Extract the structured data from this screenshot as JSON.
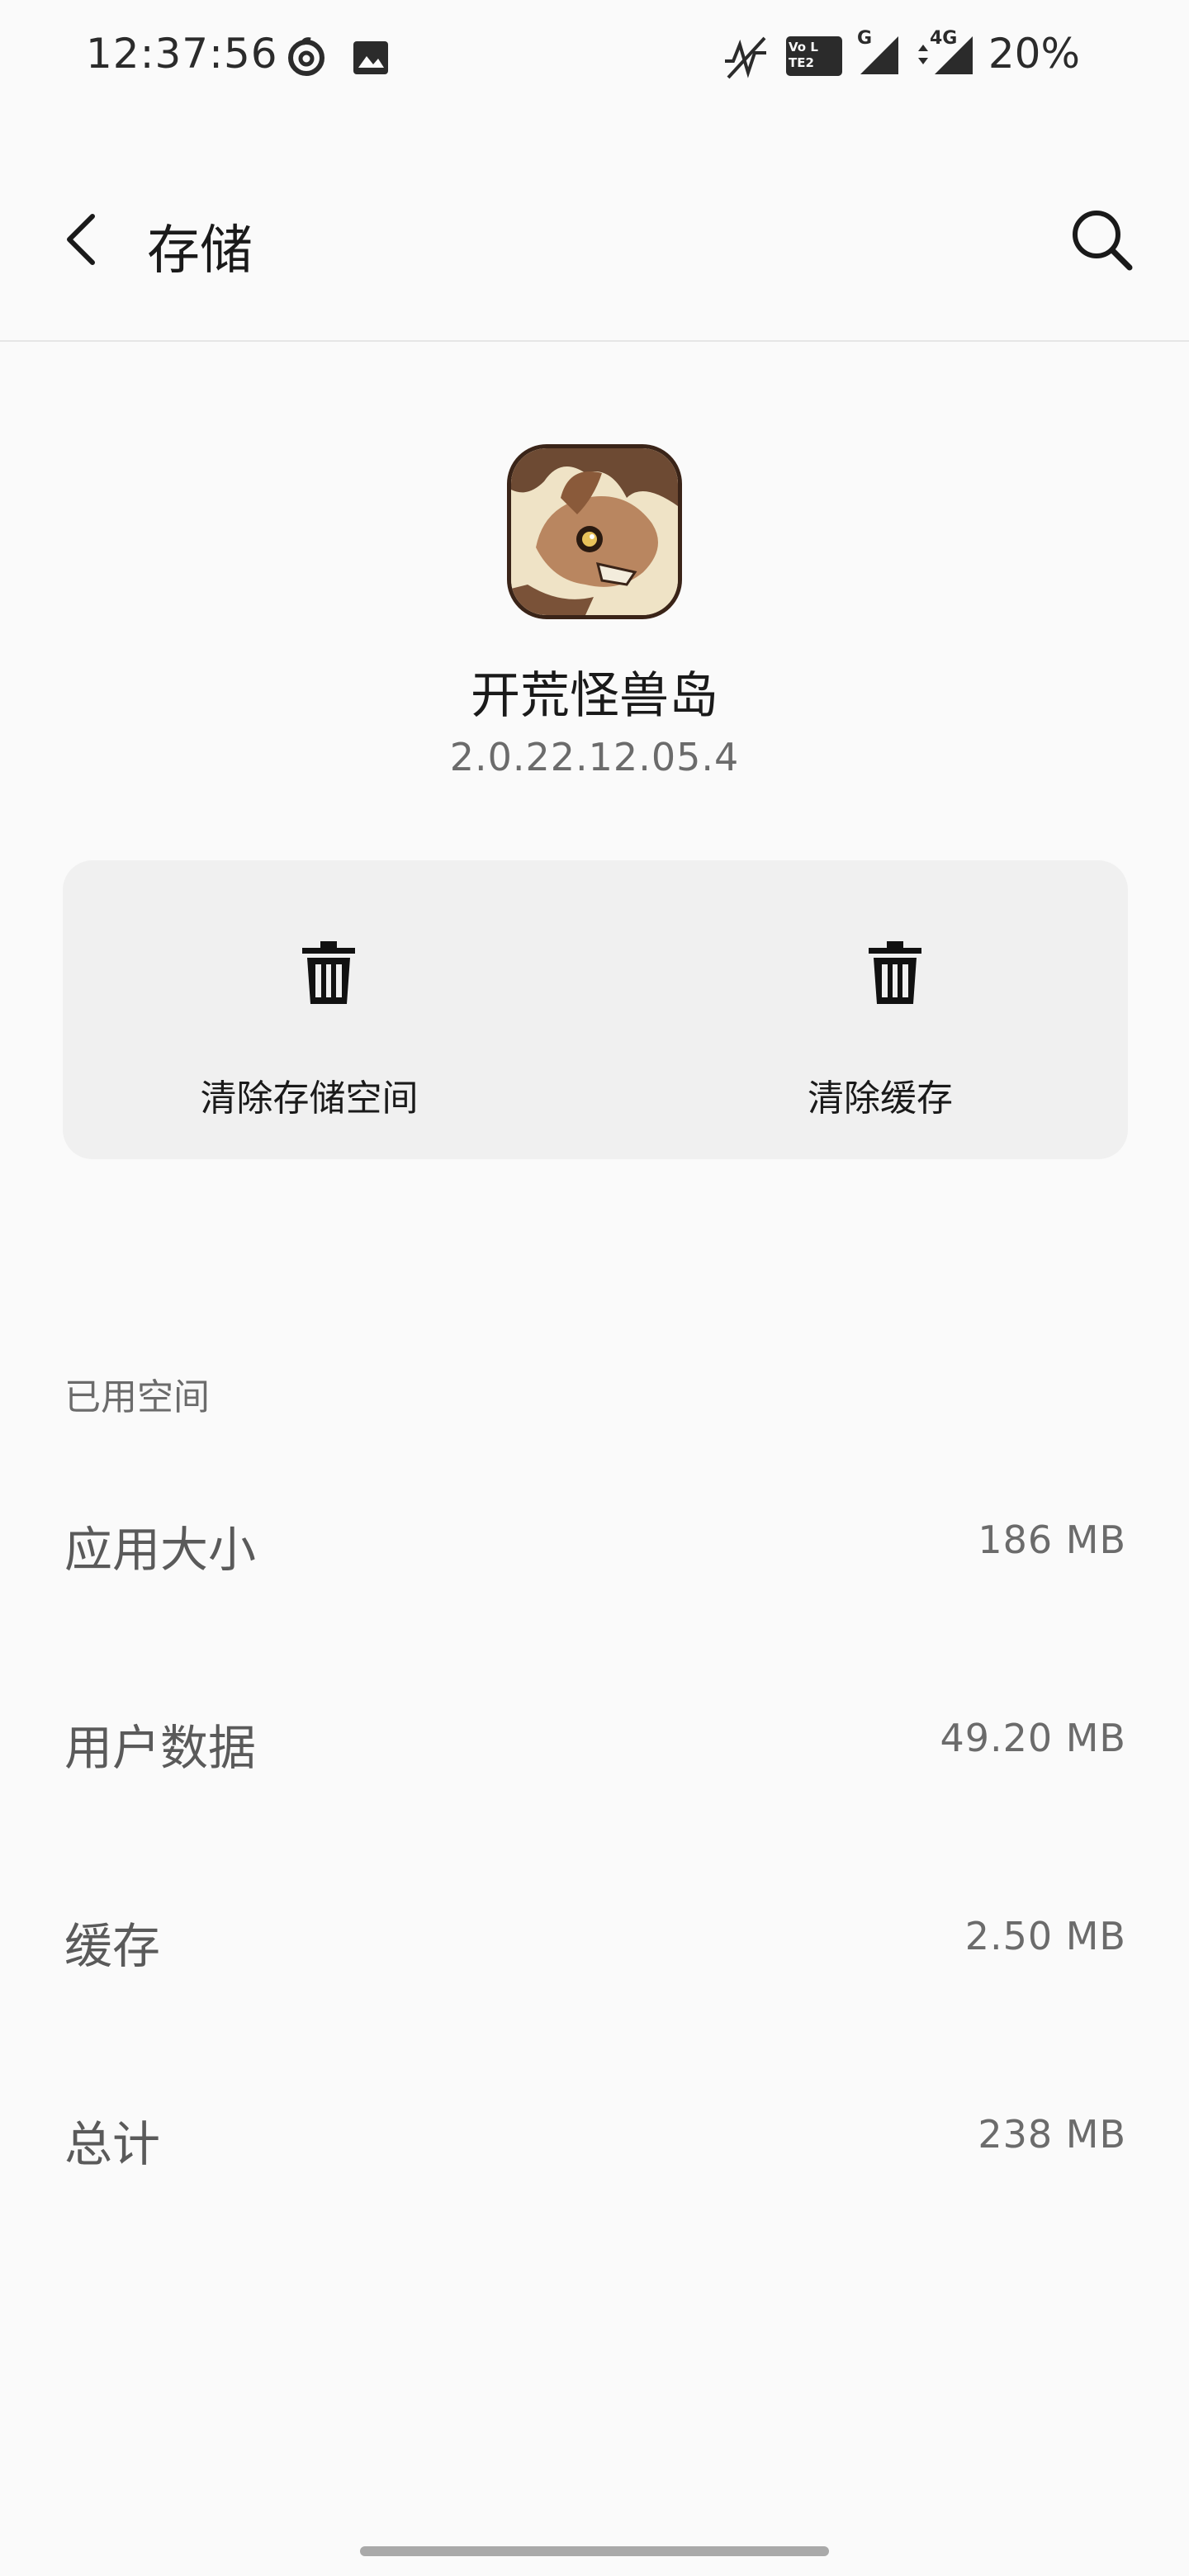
{
  "status_bar": {
    "time": "12:37:56",
    "battery": "20%",
    "icons": [
      "netease-music-icon",
      "image-notification-icon",
      "no-signal-icon",
      "volte-lte2-icon",
      "signal-g-icon",
      "signal-4g-icon"
    ],
    "volte_label": "Vo LTE2",
    "g_label": "G",
    "fourg_label": "4G"
  },
  "app_bar": {
    "title": "存储",
    "back_icon": "back-arrow-icon",
    "search_icon": "search-icon"
  },
  "app": {
    "name": "开荒怪兽岛",
    "version": "2.0.22.12.05.4"
  },
  "actions": {
    "clear_storage": "清除存储空间",
    "clear_cache": "清除缓存",
    "icon": "trash-icon"
  },
  "storage": {
    "section_title": "已用空间",
    "rows": [
      {
        "label": "应用大小",
        "value": "186 MB"
      },
      {
        "label": "用户数据",
        "value": "49.20 MB"
      },
      {
        "label": "缓存",
        "value": "2.50 MB"
      },
      {
        "label": "总计",
        "value": "238 MB"
      }
    ]
  },
  "colors": {
    "background": "#fafafa",
    "card": "#f0f0f0",
    "text_primary": "#1a1a1a",
    "text_secondary": "#6b6b6b"
  }
}
